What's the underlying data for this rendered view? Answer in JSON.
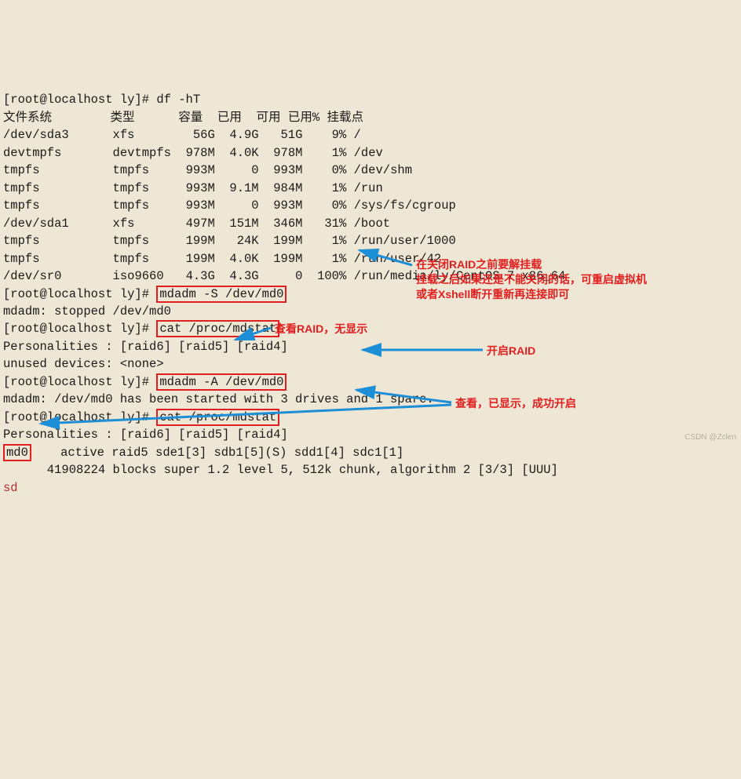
{
  "prompt": "[root@localhost ly]# ",
  "cmd_df": "df -hT",
  "df": {
    "headers": {
      "fs": "文件系统",
      "type": "类型",
      "size": "容量",
      "used": "已用",
      "avail": "可用",
      "usep": "已用%",
      "mount": "挂载点"
    },
    "rows": [
      {
        "fs": "/dev/sda3",
        "type": "xfs",
        "size": "56G",
        "used": "4.9G",
        "avail": "51G",
        "usep": "9%",
        "mount": "/"
      },
      {
        "fs": "devtmpfs",
        "type": "devtmpfs",
        "size": "978M",
        "used": "4.0K",
        "avail": "978M",
        "usep": "1%",
        "mount": "/dev"
      },
      {
        "fs": "tmpfs",
        "type": "tmpfs",
        "size": "993M",
        "used": "0",
        "avail": "993M",
        "usep": "0%",
        "mount": "/dev/shm"
      },
      {
        "fs": "tmpfs",
        "type": "tmpfs",
        "size": "993M",
        "used": "9.1M",
        "avail": "984M",
        "usep": "1%",
        "mount": "/run"
      },
      {
        "fs": "tmpfs",
        "type": "tmpfs",
        "size": "993M",
        "used": "0",
        "avail": "993M",
        "usep": "0%",
        "mount": "/sys/fs/cgroup"
      },
      {
        "fs": "/dev/sda1",
        "type": "xfs",
        "size": "497M",
        "used": "151M",
        "avail": "346M",
        "usep": "31%",
        "mount": "/boot"
      },
      {
        "fs": "tmpfs",
        "type": "tmpfs",
        "size": "199M",
        "used": "24K",
        "avail": "199M",
        "usep": "1%",
        "mount": "/run/user/1000"
      },
      {
        "fs": "tmpfs",
        "type": "tmpfs",
        "size": "199M",
        "used": "4.0K",
        "avail": "199M",
        "usep": "1%",
        "mount": "/run/user/42"
      },
      {
        "fs": "/dev/sr0",
        "type": "iso9660",
        "size": "4.3G",
        "used": "4.3G",
        "avail": "0",
        "usep": "100%",
        "mount": "/run/media/ly/CentOS 7 x86_64"
      }
    ]
  },
  "cmd_mdadm_stop": "mdadm -S /dev/md0",
  "out_mdadm_stop": "mdadm: stopped /dev/md0",
  "cmd_cat_mdstat1": "cat /proc/mdstat",
  "out_pers": "Personalities : [raid6] [raid5] [raid4]",
  "out_unused": "unused devices: <none>",
  "cmd_mdadm_start": "mdadm -A /dev/md0",
  "out_started": "mdadm: /dev/md0 has been started with 3 drives and 1 spare.",
  "cmd_cat_mdstat2": "cat /proc/mdstat",
  "md0_label": "md0",
  "md0_rest": "    active raid5 sde1[3] sdb1[5](S) sdd1[4] sdc1[1]",
  "md0_blocks": "      41908224 blocks super 1.2 level 5, 512k chunk, algorithm 2 [3/3] [UUU]",
  "sd_text": "sd",
  "anno1a": "在关闭RAID之前要解挂载",
  "anno1b": "挂载之后如果还是不能关闭的话，可重启虚拟机",
  "anno1c": "或者Xshell断开重新再连接即可",
  "anno2": "查看RAID，无显示",
  "anno3": "开启RAID",
  "anno4": "查看，已显示，成功开启",
  "watermark": "CSDN @Zclen"
}
